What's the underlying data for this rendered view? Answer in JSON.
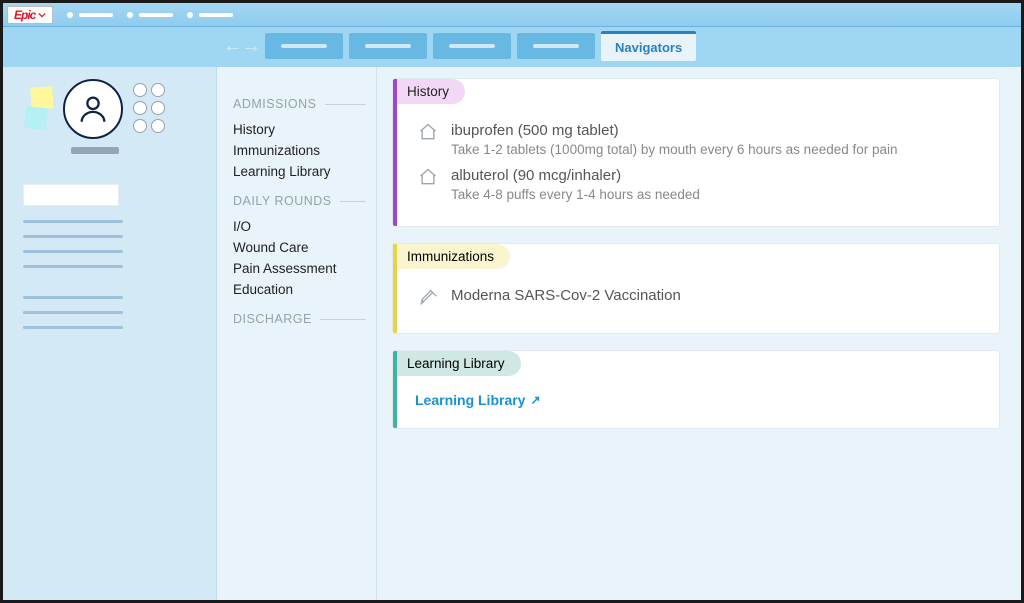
{
  "app": {
    "brand": "Epic"
  },
  "tabs": {
    "active_label": "Navigators"
  },
  "navigator": {
    "groups": [
      {
        "title": "ADMISSIONS",
        "items": [
          "History",
          "Immunizations",
          "Learning Library"
        ]
      },
      {
        "title": "DAILY ROUNDS",
        "items": [
          "I/O",
          "Wound Care",
          "Pain Assessment",
          "Education"
        ]
      },
      {
        "title": "DISCHARGE",
        "items": []
      }
    ]
  },
  "sections": {
    "history": {
      "title": "History",
      "meds": [
        {
          "name": "ibuprofen (500 mg tablet)",
          "instructions": "Take 1-2 tablets (1000mg total) by mouth every 6 hours as needed for pain"
        },
        {
          "name": "albuterol (90 mcg/inhaler)",
          "instructions": "Take 4-8 puffs every 1-4 hours as needed"
        }
      ]
    },
    "immunizations": {
      "title": "Immunizations",
      "items": [
        {
          "name": "Moderna SARS-Cov-2 Vaccination"
        }
      ]
    },
    "learning": {
      "title": "Learning Library",
      "link_label": "Learning Library"
    }
  }
}
